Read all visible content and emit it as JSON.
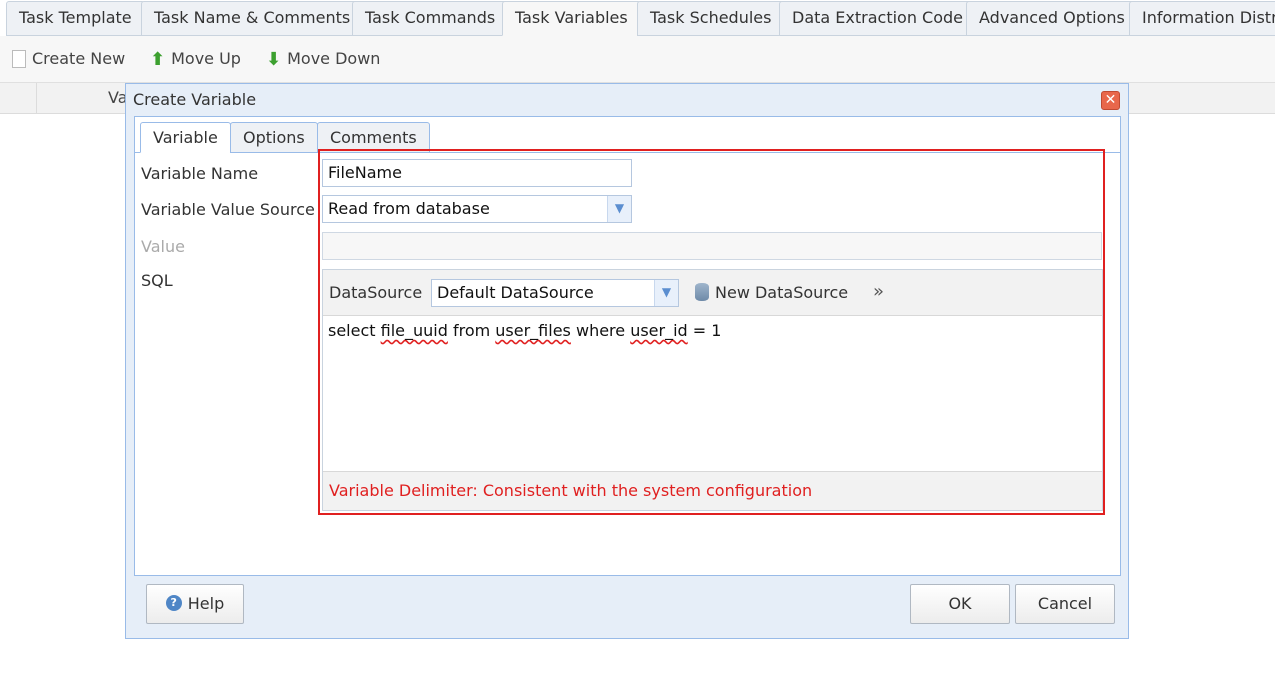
{
  "top_tabs": [
    {
      "label": "Task Template"
    },
    {
      "label": "Task Name & Comments"
    },
    {
      "label": "Task Commands"
    },
    {
      "label": "Task Variables",
      "active": true
    },
    {
      "label": "Task Schedules"
    },
    {
      "label": "Data Extraction Code"
    },
    {
      "label": "Advanced Options"
    },
    {
      "label": "Information Distrib"
    }
  ],
  "toolbar": {
    "create_new": "Create New",
    "move_up": "Move Up",
    "move_down": "Move Down"
  },
  "grid": {
    "column_label": "Va"
  },
  "dialog": {
    "title": "Create Variable",
    "tabs": [
      {
        "label": "Variable",
        "active": true
      },
      {
        "label": "Options"
      },
      {
        "label": "Comments"
      }
    ],
    "labels": {
      "variable_name": "Variable Name",
      "value_source": "Variable Value Source",
      "value": "Value",
      "sql": "SQL"
    },
    "fields": {
      "variable_name": "FileName",
      "value_source": "Read from database",
      "value": ""
    },
    "sql_panel": {
      "datasource_label": "DataSource",
      "datasource_value": "Default DataSource",
      "new_datasource": "New DataSource",
      "expand": "»",
      "query_parts": [
        "select ",
        "file_uuid",
        " from ",
        "user_files",
        " where ",
        "user_id",
        " = 1"
      ],
      "delimiter_note": "Variable Delimiter: Consistent with the system configuration"
    },
    "buttons": {
      "help": "Help",
      "ok": "OK",
      "cancel": "Cancel"
    }
  },
  "colors": {
    "highlight": "#e02020",
    "dialog_border": "#99bbe8"
  }
}
